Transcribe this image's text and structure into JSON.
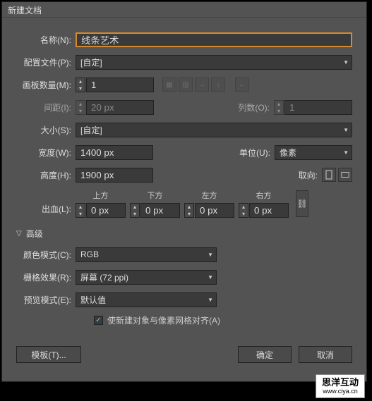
{
  "dialog": {
    "title": "新建文档"
  },
  "fields": {
    "name_label": "名称(N):",
    "name_value": "线条艺术",
    "profile_label": "配置文件(P):",
    "profile_value": "[自定]",
    "artboards_label": "画板数量(M):",
    "artboards_value": "1",
    "spacing_label": "间距(I):",
    "spacing_value": "20 px",
    "columns_label": "列数(O):",
    "columns_value": "1",
    "size_label": "大小(S):",
    "size_value": "[自定]",
    "width_label": "宽度(W):",
    "width_value": "1400 px",
    "units_label": "单位(U):",
    "units_value": "像素",
    "height_label": "高度(H):",
    "height_value": "1900 px",
    "orient_label": "取向:",
    "bleed_label": "出血(L):",
    "bleed_top": "上方",
    "bleed_bottom": "下方",
    "bleed_left": "左方",
    "bleed_right": "右方",
    "bleed_value": "0 px"
  },
  "advanced": {
    "header": "高级",
    "colormode_label": "颜色模式(C):",
    "colormode_value": "RGB",
    "raster_label": "栅格效果(R):",
    "raster_value": "屏幕 (72 ppi)",
    "preview_label": "预览模式(E):",
    "preview_value": "默认值",
    "align_label": "使新建对象与像素网格对齐(A)"
  },
  "buttons": {
    "templates": "模板(T)...",
    "ok": "确定",
    "cancel": "取消"
  },
  "watermark": {
    "main": "思洋互动",
    "sub": "www.ciya.cn"
  }
}
